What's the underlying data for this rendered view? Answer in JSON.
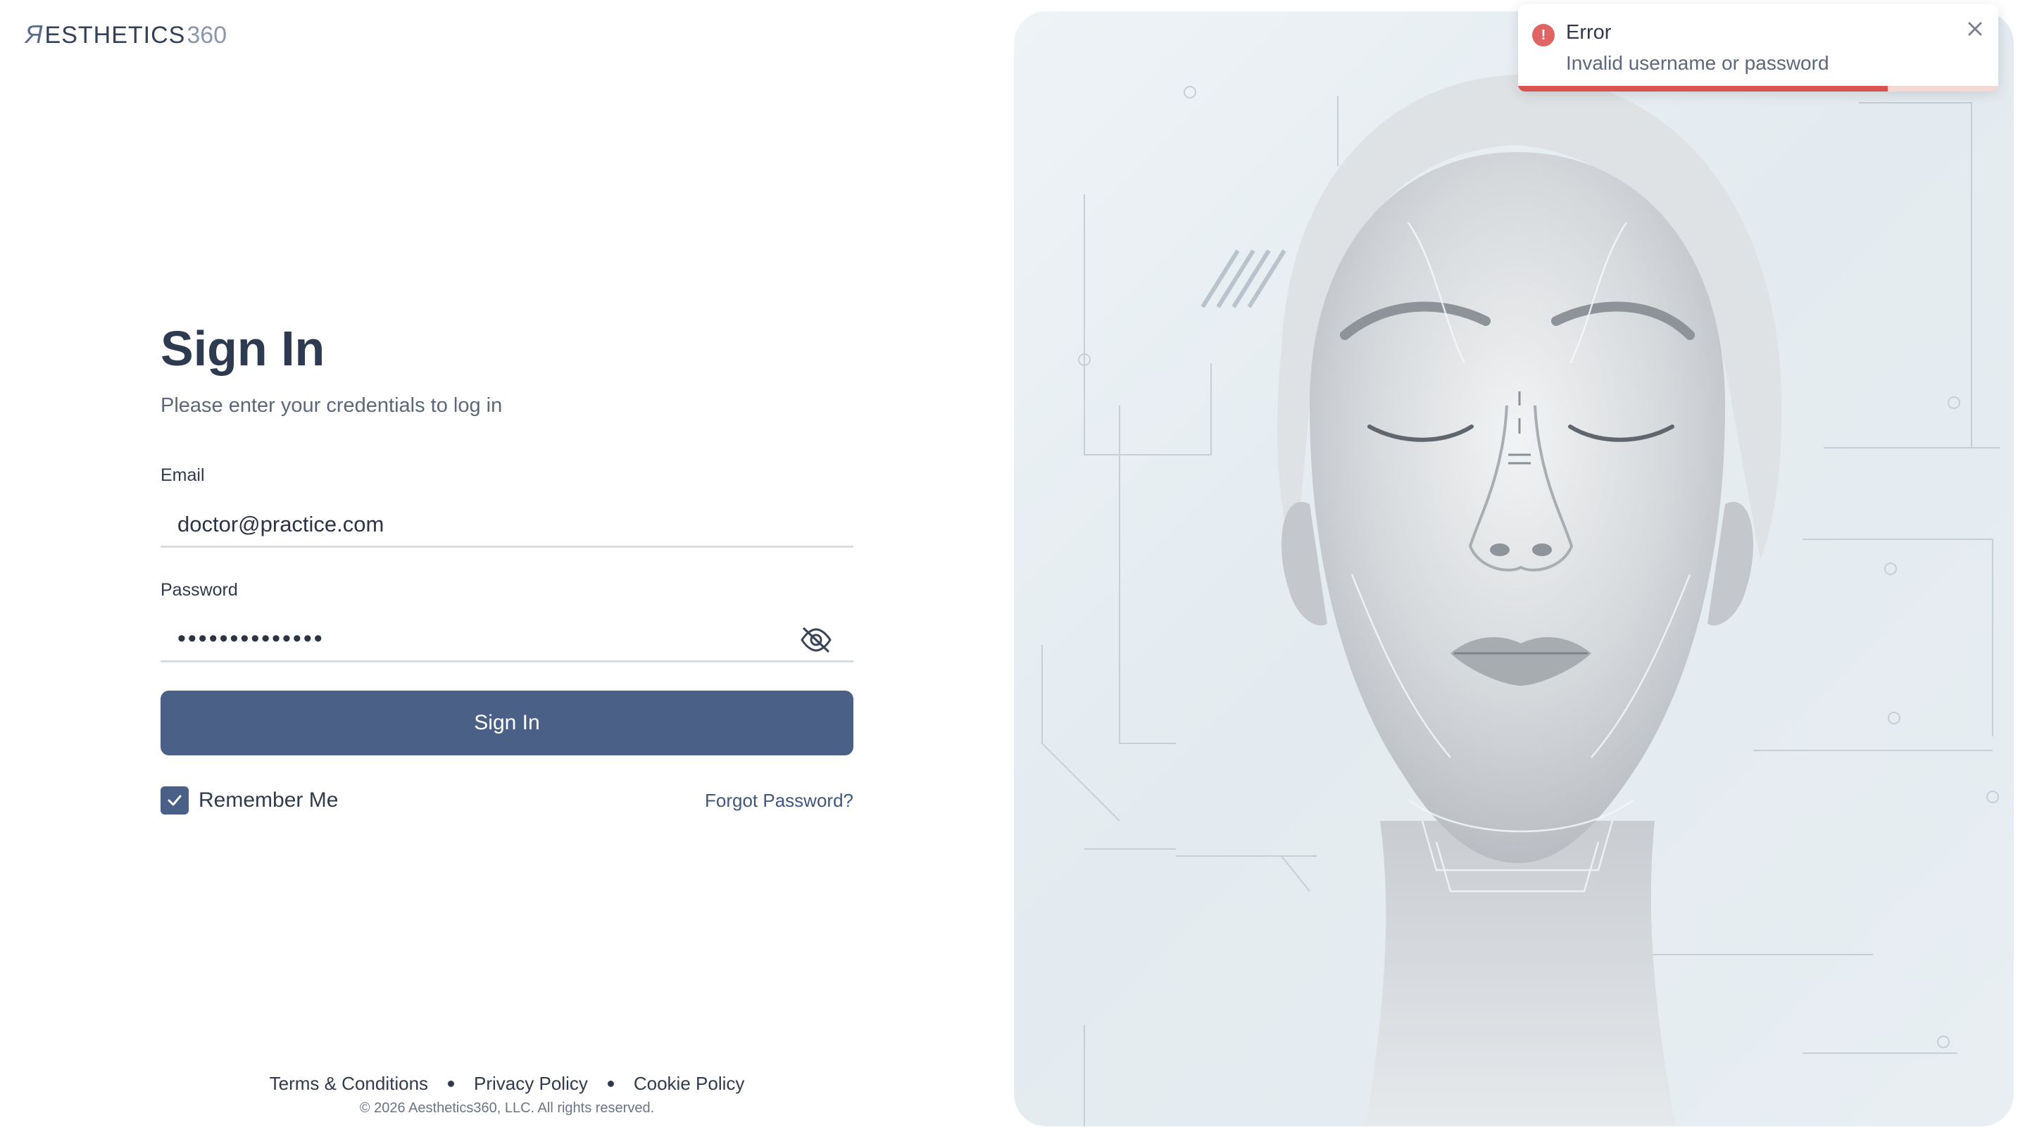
{
  "brand": {
    "logo_mark": "Я",
    "logo_text": "ESTHETICS",
    "logo_number": "360"
  },
  "form": {
    "title": "Sign In",
    "subtitle": "Please enter your credentials to log in",
    "email_label": "Email",
    "email_value": "doctor@practice.com",
    "password_label": "Password",
    "password_masked": "••••••••••••••",
    "password_toggle_icon": "eye-off-icon",
    "submit_label": "Sign In",
    "remember_label": "Remember Me",
    "remember_checked": true,
    "forgot_label": "Forgot Password?"
  },
  "footer": {
    "links": [
      "Terms & Conditions",
      "Privacy Policy",
      "Cookie Policy"
    ],
    "copyright": "© 2026 Aesthetics360, LLC. All rights reserved."
  },
  "toast": {
    "title": "Error",
    "message": "Invalid username or password",
    "icon": "error-icon",
    "progress_fraction": 0.77
  },
  "colors": {
    "primary": "#4a6086",
    "error": "#d9534f",
    "text": "#2f3a4d"
  }
}
